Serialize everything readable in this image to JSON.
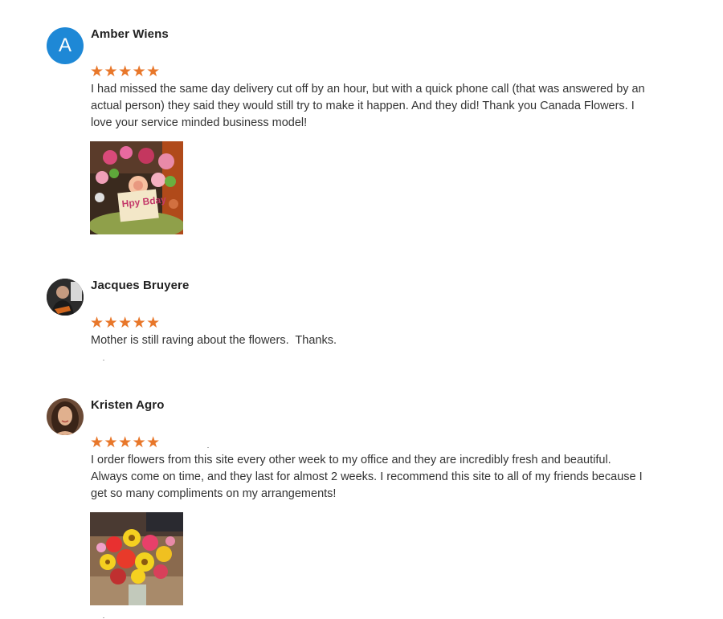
{
  "reviews": [
    {
      "name": "Amber Wiens",
      "avatar_letter": "A",
      "stars": "★★★★★",
      "text": "I had missed the same day delivery cut off by an hour, but with a quick phone call (that was answered by an actual person) they said they would still try to make it happen. And they did! Thank you Canada Flowers. I love your service minded business model!",
      "photo_text": "Hpy Bday",
      "colors": {
        "avatar_bg": "#1e88d6",
        "star": "#e8772a"
      }
    },
    {
      "name": "Jacques Bruyere",
      "stars": "★★★★★",
      "text": "Mother is still raving about the flowers.  Thanks."
    },
    {
      "name": "Kristen Agro",
      "stars": "★★★★★",
      "text": "I order flowers from this site every other week to my office and they are incredibly fresh and beautiful. Always come on time, and they last for almost 2 weeks. I recommend this site to all of my friends because I get so many compliments on my arrangements!"
    }
  ]
}
